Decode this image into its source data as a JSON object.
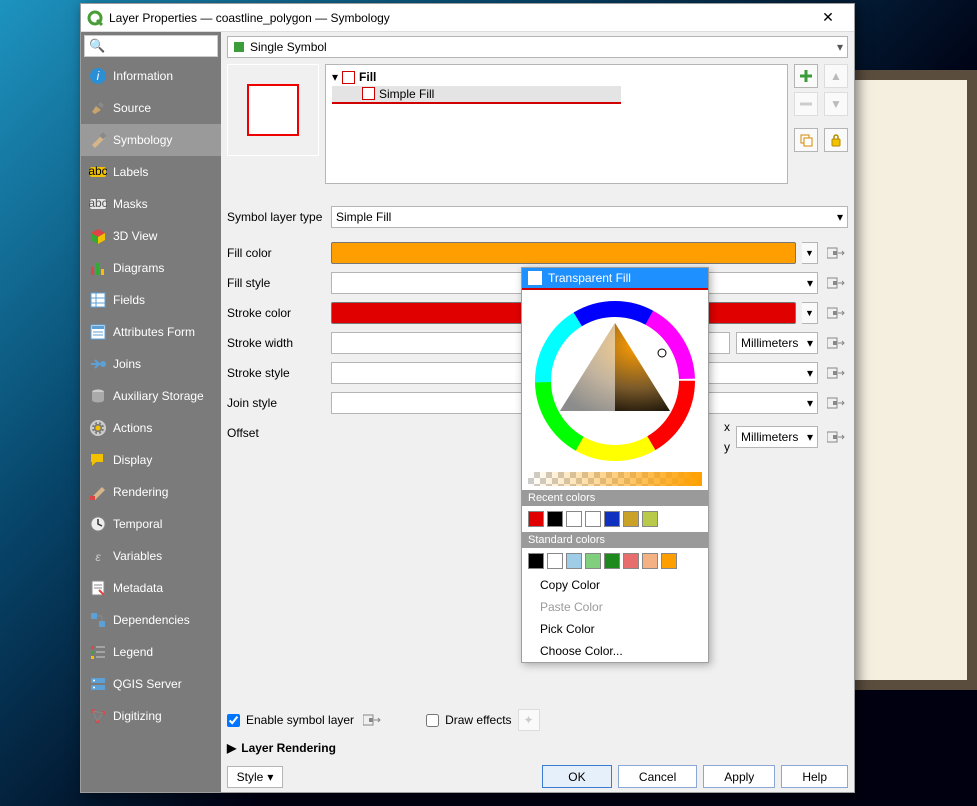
{
  "window": {
    "title": "Layer Properties — coastline_polygon — Symbology"
  },
  "sidebar": {
    "tabs": [
      {
        "label": "Information"
      },
      {
        "label": "Source"
      },
      {
        "label": "Symbology"
      },
      {
        "label": "Labels"
      },
      {
        "label": "Masks"
      },
      {
        "label": "3D View"
      },
      {
        "label": "Diagrams"
      },
      {
        "label": "Fields"
      },
      {
        "label": "Attributes Form"
      },
      {
        "label": "Joins"
      },
      {
        "label": "Auxiliary Storage"
      },
      {
        "label": "Actions"
      },
      {
        "label": "Display"
      },
      {
        "label": "Rendering"
      },
      {
        "label": "Temporal"
      },
      {
        "label": "Variables"
      },
      {
        "label": "Metadata"
      },
      {
        "label": "Dependencies"
      },
      {
        "label": "Legend"
      },
      {
        "label": "QGIS Server"
      },
      {
        "label": "Digitizing"
      }
    ]
  },
  "symbol_mode": "Single Symbol",
  "tree": {
    "root": "Fill",
    "child": "Simple Fill"
  },
  "symbol_layer_type": {
    "label": "Symbol layer type",
    "value": "Simple Fill"
  },
  "props": {
    "fill_color": {
      "label": "Fill color",
      "value": "#ff9e00"
    },
    "fill_style": {
      "label": "Fill style"
    },
    "stroke_color": {
      "label": "Stroke color",
      "value": "#e00000"
    },
    "stroke_width": {
      "label": "Stroke width",
      "unit": "Millimeters"
    },
    "stroke_style": {
      "label": "Stroke style"
    },
    "join_style": {
      "label": "Join style"
    },
    "offset": {
      "label": "Offset",
      "x": "x",
      "y": "y",
      "unit": "Millimeters"
    }
  },
  "checks": {
    "enable_symbol_layer": "Enable symbol layer",
    "draw_effects": "Draw effects"
  },
  "section": "Layer Rendering",
  "footer": {
    "style": "Style",
    "ok": "OK",
    "cancel": "Cancel",
    "apply": "Apply",
    "help": "Help"
  },
  "popup": {
    "transparent": "Transparent Fill",
    "recent_hdr": "Recent colors",
    "recent": [
      "#e00000",
      "#000000",
      "#ffffff",
      "#ffffff",
      "#1030c0",
      "#c9a227",
      "#b9c94a"
    ],
    "standard_hdr": "Standard colors",
    "standard": [
      "#000000",
      "#ffffff",
      "#9fcce6",
      "#7fcf7f",
      "#1e8a1e",
      "#e86d6d",
      "#f4b183",
      "#ff9e00"
    ],
    "copy": "Copy Color",
    "paste": "Paste Color",
    "pick": "Pick Color",
    "choose": "Choose Color..."
  }
}
